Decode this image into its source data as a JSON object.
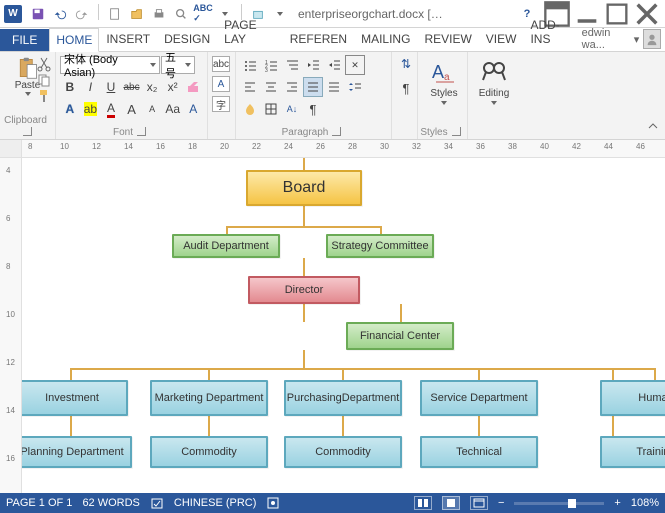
{
  "title": {
    "filename": "enterpriseorgchart.docx",
    "suffix": "[Compatibili..."
  },
  "tabs": {
    "file": "FILE",
    "home": "HOME",
    "insert": "INSERT",
    "design": "DESIGN",
    "pagelayout": "PAGE LAY",
    "references": "REFEREN",
    "mailing": "MAILING",
    "review": "REVIEW",
    "view": "VIEW",
    "addins": "ADD-INS"
  },
  "user": {
    "name": "edwin wa...",
    "dropdown": "▾"
  },
  "ribbon": {
    "clipboard": {
      "paste": "Paste",
      "label": "Clipboard"
    },
    "font": {
      "family": "宋体 (Body Asian)",
      "size": "五号",
      "bold": "B",
      "italic": "I",
      "underline": "U",
      "strike": "abc",
      "sub": "x₂",
      "sup": "x²",
      "clear": "Aₐ",
      "grow": "A",
      "shrink": "A",
      "case": "Aa",
      "highlight": "ab",
      "color": "A",
      "label": "Font"
    },
    "paragraph": {
      "label": "Paragraph"
    },
    "styles": {
      "label": "Styles",
      "btn": "Styles"
    },
    "editing": {
      "btn": "Editing"
    }
  },
  "ruler": {
    "ticks": [
      8,
      10,
      12,
      14,
      16,
      18,
      20,
      22,
      24,
      26,
      28,
      30,
      32,
      34,
      36,
      38,
      40,
      42,
      44,
      46
    ]
  },
  "vruler": {
    "ticks": [
      4,
      6,
      8,
      10,
      12,
      14,
      16
    ]
  },
  "chart_data": {
    "type": "tree",
    "nodes": {
      "board": "Board",
      "audit": "Audit Department",
      "strategy": "Strategy Committee",
      "director": "Director",
      "financial": "Financial Center",
      "investment": "Investment",
      "marketing": "Marketing Department",
      "purchasing": "PurchasingDepartment",
      "service": "Service Department",
      "human": "Human",
      "planning": "Planning Department",
      "commodity1": "Commodity",
      "commodity2": "Commodity",
      "technical": "Technical",
      "training": "Training"
    }
  },
  "status": {
    "page": "PAGE 1 OF 1",
    "words": "62 WORDS",
    "lang": "CHINESE (PRC)",
    "zoom": "108%"
  }
}
